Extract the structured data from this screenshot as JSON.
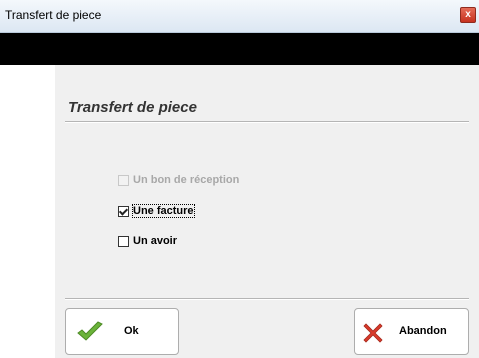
{
  "window": {
    "title": "Transfert de piece",
    "close_label": "x"
  },
  "section": {
    "heading": "Transfert de piece"
  },
  "options": [
    {
      "label": "Un bon de réception",
      "checked": false,
      "enabled": false
    },
    {
      "label": "Une facture",
      "checked": true,
      "enabled": true
    },
    {
      "label": "Un avoir",
      "checked": false,
      "enabled": true
    }
  ],
  "buttons": {
    "ok_label": "Ok",
    "cancel_label": "Abandon"
  },
  "colors": {
    "check_icon": "#6bb33a",
    "cross_icon": "#d93a2b"
  }
}
